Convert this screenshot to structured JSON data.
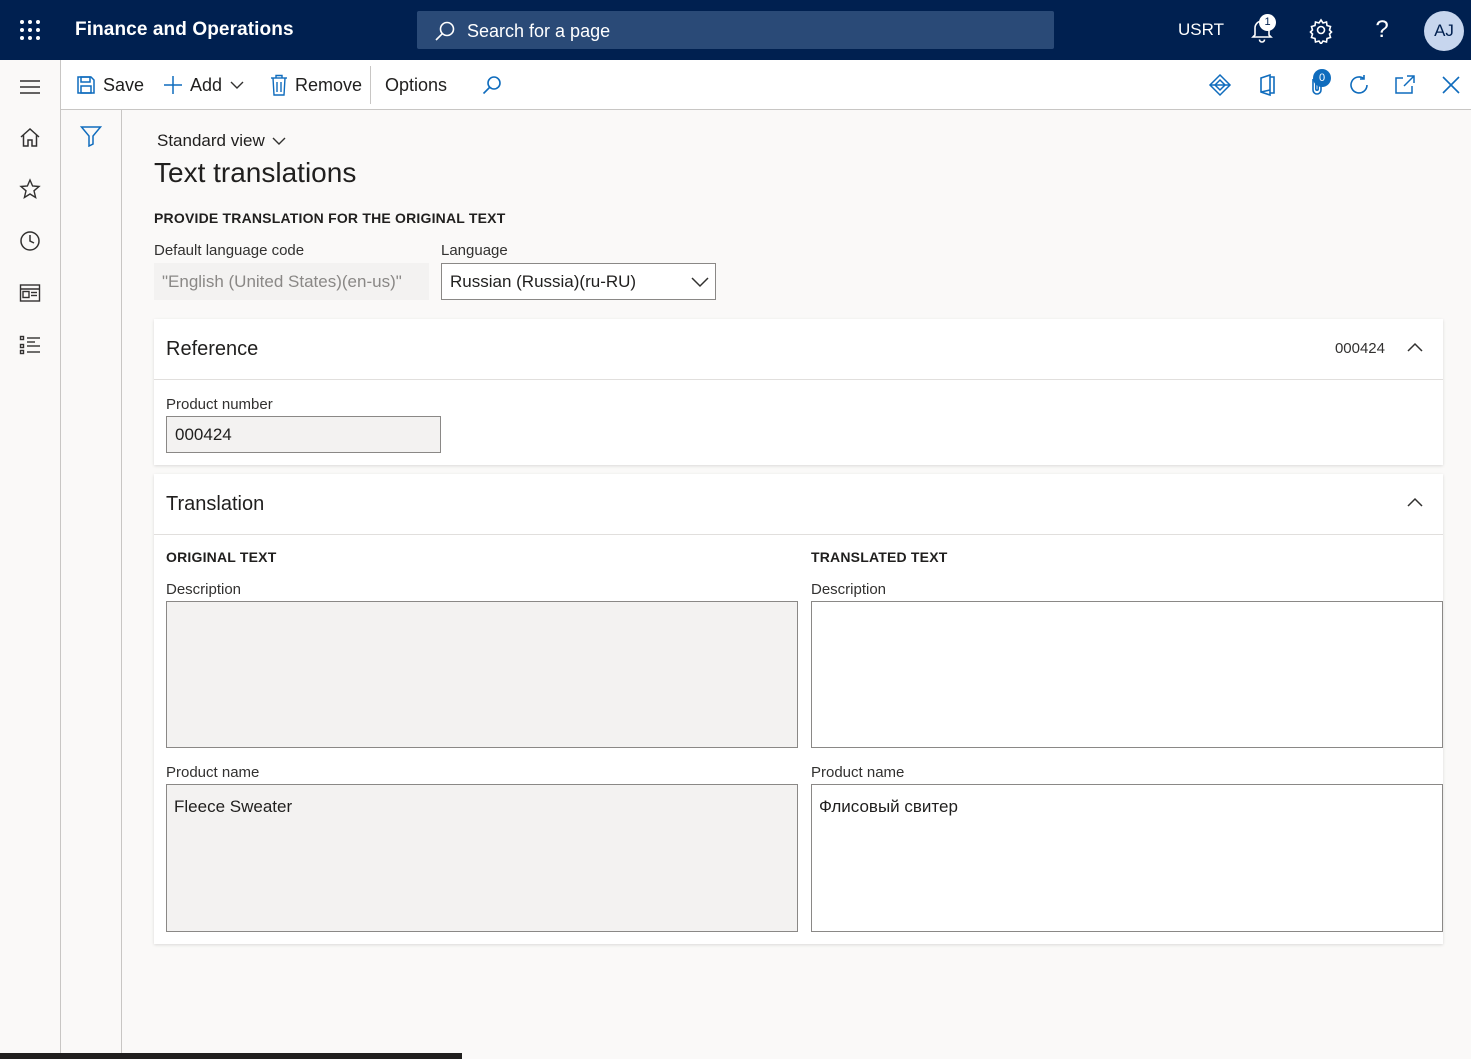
{
  "topbar": {
    "app_title": "Finance and Operations",
    "search_placeholder": "Search for a page",
    "company": "USRT",
    "notification_count": "1",
    "avatar_initials": "AJ",
    "help_glyph": "?",
    "background": "#002050"
  },
  "navrail": {
    "items": [
      "hamburger-icon",
      "home-icon",
      "star-icon",
      "clock-icon",
      "workspace-icon",
      "list-icon"
    ]
  },
  "actionpane": {
    "save_label": "Save",
    "add_label": "Add",
    "remove_label": "Remove",
    "options_label": "Options",
    "attachments_count": "0",
    "right_icons": [
      "power-apps-icon",
      "office-icon",
      "attachment-icon",
      "refresh-icon",
      "open-new-window-icon",
      "close-icon"
    ]
  },
  "page": {
    "view_selector": "Standard view",
    "title": "Text translations",
    "section_caption": "PROVIDE TRANSLATION FOR THE ORIGINAL TEXT",
    "default_language_label": "Default language code",
    "default_language_value": "\"English (United States)(en-us)\"",
    "language_label": "Language",
    "language_value": "Russian (Russia)(ru-RU)"
  },
  "reference": {
    "title": "Reference",
    "summary": "000424",
    "product_number_label": "Product number",
    "product_number_value": "000424"
  },
  "translation": {
    "title": "Translation",
    "original_caption": "ORIGINAL TEXT",
    "translated_caption": "TRANSLATED TEXT",
    "description_label": "Description",
    "product_name_label": "Product name",
    "original_description": "",
    "original_product_name": "Fleece Sweater",
    "translated_description": "",
    "translated_product_name": "Флисовый свитер"
  }
}
